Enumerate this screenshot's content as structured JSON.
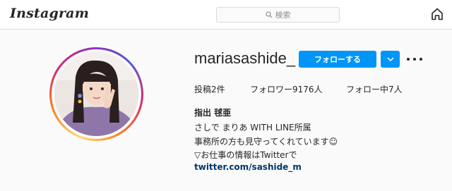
{
  "header": {
    "logo_text": "Instagram",
    "search_placeholder": "検索"
  },
  "profile": {
    "username": "mariasashide_",
    "follow_label": "フォローする",
    "stats": {
      "posts": "投稿2件",
      "followers": "フォロワー9176人",
      "following": "フォロー中7人"
    },
    "bio": {
      "name": "指出 毬亜",
      "line1": "さしで まりあ WITH LINE所属",
      "line2": "事務所の方も見守ってくれています☺",
      "line3": "▽お仕事の情報はTwitterで",
      "link": "twitter.com/sashide_m"
    }
  },
  "colors": {
    "accent": "#0095f6",
    "link": "#00376b",
    "text": "#262626",
    "muted": "#8e8e8e"
  },
  "icons": [
    "search-icon",
    "home-icon",
    "chevron-down-icon",
    "more-options-icon"
  ]
}
